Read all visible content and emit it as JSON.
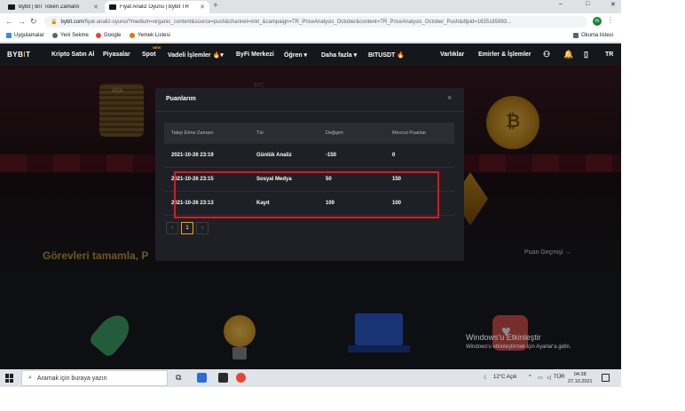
{
  "browser": {
    "tabs": [
      {
        "title": "Bybit | BIT Token Zamanlı"
      },
      {
        "title": "Fiyat Analiz Oyunu | Bybit TR"
      }
    ],
    "new_tab_symbol": "+",
    "url_host": "bybit.com",
    "url_path": "/fiyat-analiz-oyunu/?medium=organic_content&source=push&channel=mkt_&campaign=TR_PriceAnalysis_October&content=TR_PriceAnalysis_October_Push&dtpid=1635165893...",
    "profile_initial": "m",
    "bookmarks": [
      "Uygulamalar",
      "Yeni Sekme",
      "Google",
      "Yemek Listesi"
    ],
    "reading_list": "Okuma listesi",
    "window_controls": [
      "–",
      "□",
      "✕"
    ]
  },
  "site": {
    "logo_a": "BYB",
    "logo_b": "I",
    "logo_c": "T",
    "nav_left": [
      "Kripto Satın Al",
      "Piyasalar",
      "Spot",
      "Vadeli İşlemler 🔥▾",
      "ByFi Merkezi",
      "Öğren ▾",
      "Daha fazla ▾",
      "BITUSDT 🔥"
    ],
    "new_badge": "NEW",
    "nav_right": [
      "Varlıklar",
      "Emirler & İşlemler"
    ],
    "lang": "TR",
    "goals_text": "Görevleri tamamla, P",
    "points_history": "Puan Geçmişi →",
    "coin_labels": [
      "ADA",
      "BTC"
    ]
  },
  "modal": {
    "title": "Puanlarım",
    "close": "×",
    "columns": [
      "Talep Etme Zamanı",
      "Tür",
      "Değişim",
      "Mevcut Puanlar"
    ],
    "rows": [
      {
        "time": "2021-10-26 23:19",
        "type": "Günlük Analiz",
        "change": "-150",
        "current": "0"
      },
      {
        "time": "2021-10-26 23:15",
        "type": "Sosyal Medya",
        "change": "50",
        "current": "150"
      },
      {
        "time": "2021-10-26 23:13",
        "type": "Kayıt",
        "change": "100",
        "current": "100"
      }
    ],
    "pagination": {
      "prev": "‹",
      "current": "1",
      "next": "›"
    }
  },
  "windows_activation": {
    "line1": "Windows'u Etkinleştir",
    "line2": "Windows'u etkinleştirmek için Ayarlar'a gidin."
  },
  "taskbar": {
    "search_placeholder": "Aramak için buraya yazın",
    "weather": "12°C Açık",
    "lang": "TÜR",
    "time": "04:38",
    "date": "27.10.2021"
  },
  "colors": {
    "accent": "#f7a600",
    "highlight_box": "#e0191f",
    "modal_bg": "#1f2025",
    "goals_text": "#c9a227"
  }
}
